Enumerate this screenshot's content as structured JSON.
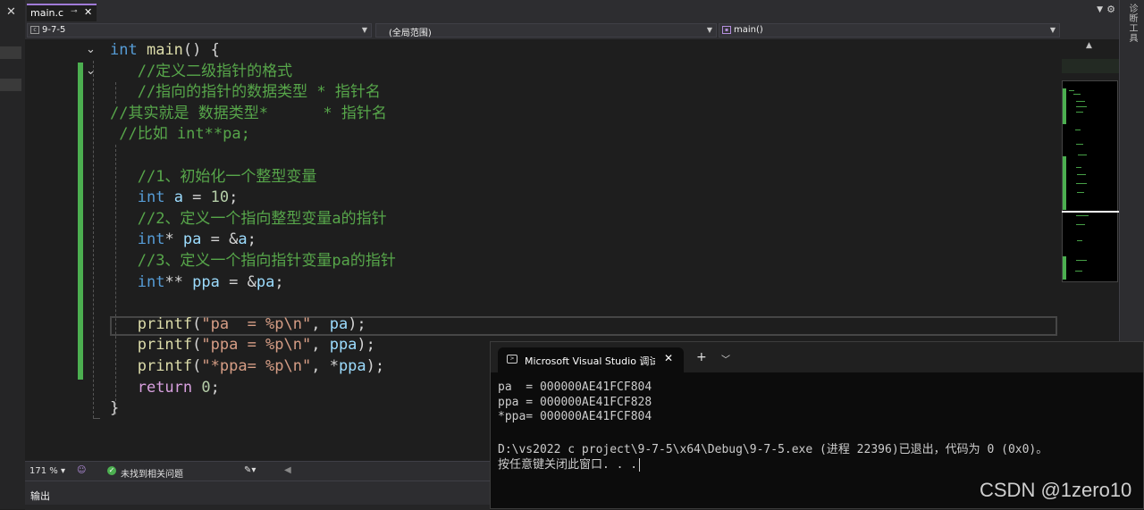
{
  "tab": {
    "filename": "main.c",
    "pin_icon": "pin-icon",
    "close": "✕"
  },
  "nav": {
    "project": "9-7-5",
    "scope": "(全局范围)",
    "function": "main()"
  },
  "right_panel": {
    "label": "诊断工具"
  },
  "code": [
    [
      [
        "kw",
        "int"
      ],
      [
        "pl",
        " "
      ],
      [
        "fn",
        "main"
      ],
      [
        "pl",
        "() {"
      ]
    ],
    [
      [
        "cm",
        "   //定义二级指针的格式"
      ]
    ],
    [
      [
        "cm",
        "   //指向的指针的数据类型 * 指针名"
      ]
    ],
    [
      [
        "cm",
        "//其实就是 数据类型*      * 指针名"
      ]
    ],
    [
      [
        "cm",
        " //比如 int**pa;"
      ]
    ],
    [
      [
        "pl",
        ""
      ]
    ],
    [
      [
        "pl",
        "   "
      ],
      [
        "cm",
        "//1、初始化一个整型变量"
      ]
    ],
    [
      [
        "pl",
        "   "
      ],
      [
        "kw",
        "int"
      ],
      [
        "pl",
        " "
      ],
      [
        "id",
        "a"
      ],
      [
        "pl",
        " = "
      ],
      [
        "nm",
        "10"
      ],
      [
        "pl",
        ";"
      ]
    ],
    [
      [
        "pl",
        "   "
      ],
      [
        "cm",
        "//2、定义一个指向整型变量a的指针"
      ]
    ],
    [
      [
        "pl",
        "   "
      ],
      [
        "kw",
        "int"
      ],
      [
        "pl",
        "* "
      ],
      [
        "id",
        "pa"
      ],
      [
        "pl",
        " = &"
      ],
      [
        "id",
        "a"
      ],
      [
        "pl",
        ";"
      ]
    ],
    [
      [
        "pl",
        "   "
      ],
      [
        "cm",
        "//3、定义一个指向指针变量pa的指针"
      ]
    ],
    [
      [
        "pl",
        "   "
      ],
      [
        "kw",
        "int"
      ],
      [
        "pl",
        "** "
      ],
      [
        "id",
        "ppa"
      ],
      [
        "pl",
        " = &"
      ],
      [
        "id",
        "pa"
      ],
      [
        "pl",
        ";"
      ]
    ],
    [
      [
        "pl",
        ""
      ]
    ],
    [
      [
        "pl",
        "   "
      ],
      [
        "fn",
        "printf"
      ],
      [
        "pl",
        "("
      ],
      [
        "st",
        "\"pa  = %p\\n\""
      ],
      [
        "pl",
        ", "
      ],
      [
        "id",
        "pa"
      ],
      [
        "pl",
        ");"
      ]
    ],
    [
      [
        "pl",
        "   "
      ],
      [
        "fn",
        "printf"
      ],
      [
        "pl",
        "("
      ],
      [
        "st",
        "\"ppa = %p\\n\""
      ],
      [
        "pl",
        ", "
      ],
      [
        "id",
        "ppa"
      ],
      [
        "pl",
        ");"
      ]
    ],
    [
      [
        "pl",
        "   "
      ],
      [
        "fn",
        "printf"
      ],
      [
        "pl",
        "("
      ],
      [
        "st",
        "\"*ppa= %p\\n\""
      ],
      [
        "pl",
        ", *"
      ],
      [
        "id",
        "ppa"
      ],
      [
        "pl",
        ");"
      ]
    ],
    [
      [
        "pl",
        "   "
      ],
      [
        "ctl",
        "return"
      ],
      [
        "pl",
        " "
      ],
      [
        "nm",
        "0"
      ],
      [
        "pl",
        ";"
      ]
    ],
    [
      [
        "pl",
        "}"
      ]
    ]
  ],
  "status": {
    "zoom": "171 %",
    "issues": "未找到相关问题"
  },
  "output_panel": {
    "title": "输出"
  },
  "console": {
    "title": "Microsoft Visual Studio 调试控制台",
    "close": "✕",
    "plus": "+",
    "lines": [
      "pa  = 000000AE41FCF804",
      "ppa = 000000AE41FCF828",
      "*ppa= 000000AE41FCF804",
      "",
      "D:\\vs2022 c project\\9-7-5\\x64\\Debug\\9-7-5.exe (进程 22396)已退出，代码为 0 (0x0)。",
      "按任意键关闭此窗口. . ."
    ]
  },
  "watermark": "CSDN @1zero10",
  "colors": {
    "accent": "#a07bd8",
    "change_bar": "#4caf50",
    "keyword": "#569cd6",
    "comment": "#57a64a"
  }
}
